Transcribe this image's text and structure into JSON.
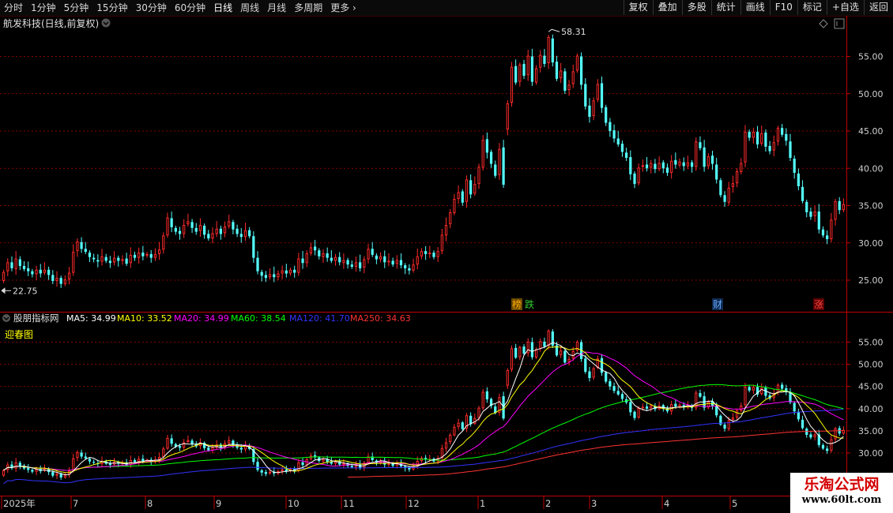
{
  "toolbar": {
    "periods": [
      {
        "label": "分时"
      },
      {
        "label": "1分钟"
      },
      {
        "label": "5分钟"
      },
      {
        "label": "15分钟"
      },
      {
        "label": "30分钟"
      },
      {
        "label": "60分钟"
      },
      {
        "label": "日线",
        "active": true
      },
      {
        "label": "周线"
      },
      {
        "label": "月线"
      },
      {
        "label": "多周期"
      },
      {
        "label": "更多"
      }
    ],
    "actions": [
      "复权",
      "叠加",
      "多股",
      "统计",
      "画线",
      "F10",
      "标记",
      "+自选",
      "返回"
    ]
  },
  "main_chart": {
    "title": "航发科技(日线,前复权)",
    "high_label": "58.31",
    "low_label": "22.75",
    "y_ticks": [
      "55.00",
      "50.00",
      "45.00",
      "40.00",
      "35.00",
      "30.00",
      "25.00"
    ],
    "events": [
      {
        "label": "榜",
        "color": "#ffaa00",
        "bg": "#6b4a00"
      },
      {
        "label": "跌",
        "color": "#33cc33",
        "bg": ""
      },
      {
        "label": "财",
        "color": "#66aaff",
        "bg": "#102a50"
      },
      {
        "label": "涨",
        "color": "#ff4444",
        "bg": "#5a0000"
      }
    ]
  },
  "indicator": {
    "name": "股朋指标网",
    "subtitle": "迎春图",
    "ma_legend": [
      {
        "label": "MA5: 34.99",
        "color": "#ffffff"
      },
      {
        "label": "MA10: 33.52",
        "color": "#ffff00"
      },
      {
        "label": "MA20: 34.99",
        "color": "#ff00ff"
      },
      {
        "label": "MA60: 38.54",
        "color": "#00ff00"
      },
      {
        "label": "MA120: 41.70",
        "color": "#3333ff"
      },
      {
        "label": "MA250: 34.63",
        "color": "#ff3333"
      }
    ],
    "y_ticks": [
      "55.00",
      "50.00",
      "45.00",
      "40.00",
      "35.00",
      "30.00"
    ]
  },
  "x_axis": {
    "labels": [
      "2025年",
      "7",
      "8",
      "9",
      "10",
      "11",
      "12",
      "1",
      "2",
      "3",
      "4",
      "5"
    ]
  },
  "watermark": {
    "title": "乐淘公式网",
    "url": "www.60lt.com"
  },
  "colors": {
    "up": "#ff2a2a",
    "down": "#54ffff",
    "grid": "#b00000",
    "axis": "#c00000"
  },
  "chart_data": {
    "type": "candlestick",
    "unit": "price",
    "open_close": [
      [
        24.9,
        26.1
      ],
      [
        26.2,
        27.4
      ],
      [
        27.4,
        26.6
      ],
      [
        26.5,
        27.9
      ],
      [
        27.8,
        26.9
      ],
      [
        26.9,
        26.5
      ],
      [
        26.6,
        26.2
      ],
      [
        26.2,
        25.8
      ],
      [
        25.8,
        26.4
      ],
      [
        26.4,
        25.9
      ],
      [
        26.0,
        26.4
      ],
      [
        26.4,
        25.7
      ],
      [
        25.7,
        24.9
      ],
      [
        24.9,
        25.3
      ],
      [
        25.3,
        24.5
      ],
      [
        24.5,
        25.1
      ],
      [
        25.1,
        26.0
      ],
      [
        26.0,
        28.8
      ],
      [
        28.9,
        30.2
      ],
      [
        30.1,
        29.2
      ],
      [
        29.2,
        28.8
      ],
      [
        28.7,
        28.1
      ],
      [
        28.0,
        27.8
      ],
      [
        27.7,
        27.5
      ],
      [
        27.5,
        28.2
      ],
      [
        28.1,
        27.6
      ],
      [
        27.6,
        27.3
      ],
      [
        27.4,
        28.0
      ],
      [
        28.0,
        27.6
      ],
      [
        27.6,
        27.8
      ],
      [
        27.9,
        27.2
      ],
      [
        27.3,
        28.4
      ],
      [
        28.4,
        28.0
      ],
      [
        28.0,
        28.7
      ],
      [
        28.7,
        28.2
      ],
      [
        28.3,
        28.5
      ],
      [
        28.5,
        28.0
      ],
      [
        28.0,
        28.5
      ],
      [
        28.5,
        29.1
      ],
      [
        29.1,
        31.0
      ],
      [
        31.0,
        33.4
      ],
      [
        33.3,
        32.1
      ],
      [
        32.0,
        31.5
      ],
      [
        31.6,
        31.2
      ],
      [
        31.2,
        32.4
      ],
      [
        32.5,
        32.9
      ],
      [
        32.8,
        32.0
      ],
      [
        32.0,
        31.5
      ],
      [
        31.6,
        32.4
      ],
      [
        32.3,
        31.1
      ],
      [
        31.2,
        30.6
      ],
      [
        30.6,
        31.3
      ],
      [
        31.2,
        31.9
      ],
      [
        31.9,
        31.2
      ],
      [
        31.3,
        32.2
      ],
      [
        32.2,
        32.9
      ],
      [
        32.8,
        31.8
      ],
      [
        31.9,
        31.2
      ],
      [
        31.2,
        30.8
      ],
      [
        30.8,
        31.7
      ],
      [
        31.7,
        30.9
      ],
      [
        30.9,
        28.0
      ],
      [
        28.0,
        26.2
      ],
      [
        26.1,
        25.6
      ],
      [
        25.7,
        25.3
      ],
      [
        25.4,
        25.8
      ],
      [
        25.8,
        25.4
      ],
      [
        25.4,
        25.9
      ],
      [
        25.9,
        26.3
      ],
      [
        26.3,
        25.9
      ],
      [
        25.9,
        26.4
      ],
      [
        26.4,
        26.0
      ],
      [
        26.0,
        27.9
      ],
      [
        27.9,
        27.3
      ],
      [
        27.3,
        28.6
      ],
      [
        28.6,
        29.4
      ],
      [
        29.5,
        29.0
      ],
      [
        29.0,
        28.2
      ],
      [
        28.1,
        28.6
      ],
      [
        28.6,
        28.0
      ],
      [
        28.0,
        27.6
      ],
      [
        27.6,
        28.1
      ],
      [
        28.1,
        27.4
      ],
      [
        27.3,
        27.7
      ],
      [
        27.7,
        27.1
      ],
      [
        27.1,
        26.8
      ],
      [
        26.8,
        27.4
      ],
      [
        27.4,
        26.6
      ],
      [
        26.7,
        27.8
      ],
      [
        27.8,
        29.2
      ],
      [
        29.2,
        28.4
      ],
      [
        28.3,
        27.8
      ],
      [
        27.8,
        28.2
      ],
      [
        28.2,
        27.4
      ],
      [
        27.4,
        27.6
      ],
      [
        27.6,
        27.1
      ],
      [
        27.2,
        27.7
      ],
      [
        27.7,
        27.0
      ],
      [
        27.0,
        26.6
      ],
      [
        26.6,
        26.3
      ],
      [
        26.3,
        27.1
      ],
      [
        27.1,
        28.2
      ],
      [
        28.2,
        28.9
      ],
      [
        28.9,
        28.5
      ],
      [
        28.5,
        28.7
      ],
      [
        28.7,
        28.1
      ],
      [
        28.1,
        28.9
      ],
      [
        28.9,
        31.1
      ],
      [
        31.0,
        32.4
      ],
      [
        32.5,
        34.1
      ],
      [
        34.0,
        35.9
      ],
      [
        35.9,
        36.8
      ],
      [
        36.9,
        35.4
      ],
      [
        35.5,
        38.5
      ],
      [
        38.4,
        36.5
      ],
      [
        36.6,
        37.9
      ],
      [
        37.9,
        40.2
      ],
      [
        40.1,
        43.8
      ],
      [
        43.9,
        42.1
      ],
      [
        42.2,
        40.6
      ],
      [
        40.5,
        39.0
      ],
      [
        39.1,
        42.6
      ],
      [
        42.8,
        37.8
      ],
      [
        45.2,
        48.7
      ],
      [
        48.8,
        53.6
      ],
      [
        53.7,
        51.5
      ],
      [
        51.6,
        53.9
      ],
      [
        54.0,
        52.4
      ],
      [
        52.5,
        55.1
      ],
      [
        55.0,
        51.6
      ],
      [
        51.5,
        53.4
      ],
      [
        53.5,
        55.2
      ],
      [
        55.1,
        54.0
      ],
      [
        54.1,
        57.6
      ],
      [
        57.4,
        54.2
      ],
      [
        54.3,
        52.0
      ],
      [
        52.1,
        53.1
      ],
      [
        53.0,
        50.4
      ],
      [
        50.5,
        51.2
      ],
      [
        51.3,
        53.0
      ],
      [
        53.1,
        55.1
      ],
      [
        55.0,
        51.2
      ],
      [
        51.3,
        48.3
      ],
      [
        48.4,
        46.9
      ],
      [
        47.0,
        49.1
      ],
      [
        49.2,
        51.3
      ],
      [
        51.4,
        48.1
      ],
      [
        48.2,
        46.1
      ],
      [
        46.2,
        45.0
      ],
      [
        45.1,
        44.0
      ],
      [
        44.0,
        43.2
      ],
      [
        43.3,
        42.2
      ],
      [
        42.1,
        41.4
      ],
      [
        41.5,
        39.2
      ],
      [
        39.3,
        37.9
      ],
      [
        38.0,
        40.1
      ],
      [
        40.2,
        40.4
      ],
      [
        40.5,
        40.0
      ],
      [
        40.1,
        40.7
      ],
      [
        40.6,
        39.9
      ],
      [
        39.9,
        40.7
      ],
      [
        40.8,
        40.0
      ],
      [
        40.1,
        39.4
      ],
      [
        39.4,
        41.0
      ],
      [
        41.1,
        40.5
      ],
      [
        40.4,
        40.9
      ],
      [
        40.8,
        40.3
      ],
      [
        40.3,
        40.8
      ],
      [
        40.8,
        40.2
      ],
      [
        40.2,
        43.6
      ],
      [
        43.5,
        42.7
      ],
      [
        42.8,
        40.2
      ],
      [
        40.3,
        41.6
      ],
      [
        41.7,
        40.6
      ],
      [
        40.5,
        38.5
      ],
      [
        38.4,
        36.4
      ],
      [
        36.4,
        35.5
      ],
      [
        35.4,
        37.4
      ],
      [
        37.5,
        38.0
      ],
      [
        38.0,
        39.6
      ],
      [
        39.5,
        40.7
      ],
      [
        40.8,
        44.9
      ],
      [
        44.9,
        44.1
      ],
      [
        44.1,
        44.9
      ],
      [
        44.9,
        43.2
      ],
      [
        43.3,
        44.7
      ],
      [
        44.8,
        42.9
      ],
      [
        43.0,
        42.3
      ],
      [
        42.4,
        43.5
      ],
      [
        43.6,
        45.4
      ],
      [
        45.4,
        44.5
      ],
      [
        44.6,
        43.7
      ],
      [
        43.6,
        41.4
      ],
      [
        41.3,
        39.4
      ],
      [
        39.3,
        37.6
      ],
      [
        37.5,
        35.6
      ],
      [
        35.5,
        34.1
      ],
      [
        34.2,
        33.5
      ],
      [
        33.6,
        34.2
      ],
      [
        34.2,
        31.8
      ],
      [
        31.8,
        31.0
      ],
      [
        31.0,
        30.5
      ],
      [
        30.5,
        33.1
      ],
      [
        33.1,
        35.6
      ],
      [
        35.6,
        34.4
      ],
      [
        34.4,
        35.2
      ]
    ]
  }
}
